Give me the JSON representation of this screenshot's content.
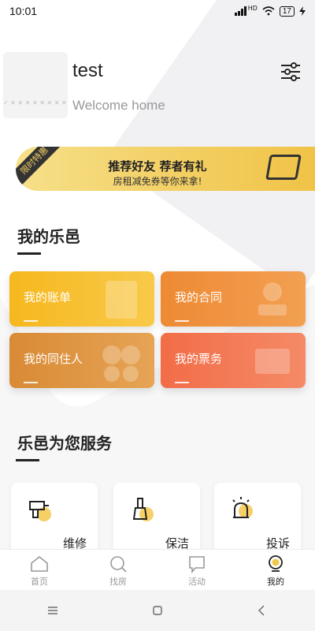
{
  "status_bar": {
    "time": "10:01",
    "network": "HD",
    "battery": "17"
  },
  "profile": {
    "username": "test",
    "welcome": "Welcome home",
    "avatar_text": "✓ ✕ ✕ ✕ ✕ ✕ ✕ ✕ ✕ ✓ ✕"
  },
  "banner": {
    "tag": "限时特惠",
    "title": "推荐好友 荐者有礼",
    "subtitle": "房租减免券等你来拿!"
  },
  "sections": {
    "my": "我的乐邑",
    "service": "乐邑为您服务"
  },
  "cards": [
    {
      "label": "我的账单",
      "color": "#f6b81e"
    },
    {
      "label": "我的合同",
      "color": "#f0913a"
    },
    {
      "label": "我的同住人",
      "color": "#e1913a"
    },
    {
      "label": "我的票务",
      "color": "#f37a55"
    }
  ],
  "services": [
    {
      "label": "维修",
      "icon": "drill-icon"
    },
    {
      "label": "保洁",
      "icon": "broom-icon"
    },
    {
      "label": "投诉",
      "icon": "alarm-icon"
    }
  ],
  "tabs": [
    {
      "label": "首页",
      "icon": "home-icon"
    },
    {
      "label": "找房",
      "icon": "search-icon"
    },
    {
      "label": "活动",
      "icon": "flag-icon"
    },
    {
      "label": "我的",
      "icon": "profile-icon"
    }
  ],
  "colors": {
    "accent": "#f3c84a",
    "text": "#222222",
    "muted": "#999999"
  }
}
